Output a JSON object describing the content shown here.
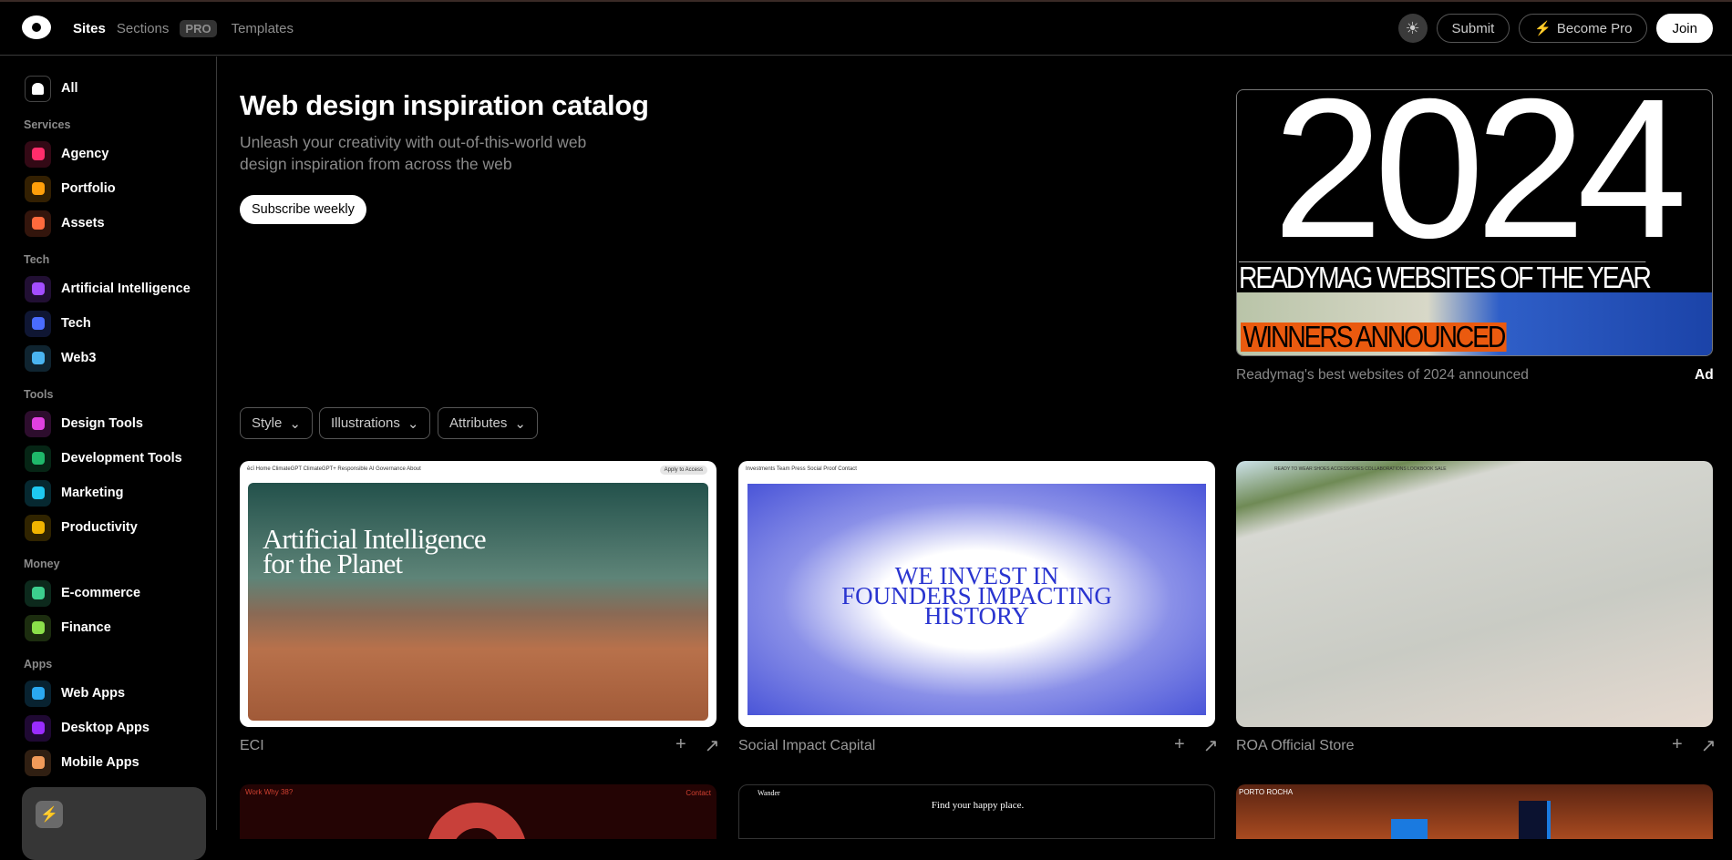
{
  "header": {
    "nav": [
      {
        "label": "Sites",
        "active": true
      },
      {
        "label": "Sections",
        "badge": "PRO"
      },
      {
        "label": "Templates"
      }
    ],
    "theme_icon": "sun-icon",
    "submit": "Submit",
    "become_pro": "Become Pro",
    "join": "Join"
  },
  "sidebar": {
    "all": "All",
    "groups": [
      {
        "label": "Services",
        "items": [
          {
            "label": "Agency",
            "icon": "people-icon",
            "color": "#ff2d6b"
          },
          {
            "label": "Portfolio",
            "icon": "person-icon",
            "color": "#ff9f0a"
          },
          {
            "label": "Assets",
            "icon": "box-icon",
            "color": "#ff6a3d"
          }
        ]
      },
      {
        "label": "Tech",
        "items": [
          {
            "label": "Artificial Intelligence",
            "icon": "sparkle-icon",
            "color": "#a34dff"
          },
          {
            "label": "Tech",
            "icon": "chip-icon",
            "color": "#4a6cff"
          },
          {
            "label": "Web3",
            "icon": "cloud-icon",
            "color": "#4ab4f0"
          }
        ]
      },
      {
        "label": "Tools",
        "items": [
          {
            "label": "Design Tools",
            "icon": "vector-icon",
            "color": "#e040e0"
          },
          {
            "label": "Development Tools",
            "icon": "code-icon",
            "color": "#1fb86a"
          },
          {
            "label": "Marketing",
            "icon": "tag-icon",
            "color": "#1ec8f0"
          },
          {
            "label": "Productivity",
            "icon": "person-check-icon",
            "color": "#f0b400"
          }
        ]
      },
      {
        "label": "Money",
        "items": [
          {
            "label": "E-commerce",
            "icon": "bag-icon",
            "color": "#3ccf8e"
          },
          {
            "label": "Finance",
            "icon": "wallet-icon",
            "color": "#8be04a"
          }
        ]
      },
      {
        "label": "Apps",
        "items": [
          {
            "label": "Web Apps",
            "icon": "compass-icon",
            "color": "#2aa8f0"
          },
          {
            "label": "Desktop Apps",
            "icon": "monitor-icon",
            "color": "#9a2cff"
          },
          {
            "label": "Mobile Apps",
            "icon": "phone-icon",
            "color": "#f09a5a"
          }
        ]
      }
    ]
  },
  "hero": {
    "title": "Web design inspiration catalog",
    "subtitle": "Unleash your creativity with out-of-this-world web design inspiration from across the web",
    "subscribe": "Subscribe weekly"
  },
  "ad": {
    "year": "2024",
    "line1": "READYMAG WEBSITES OF THE YEAR",
    "line2": "WINNERS ANNOUNCED",
    "caption": "Readymag's best websites of 2024 announced",
    "label": "Ad"
  },
  "filters": [
    "Style",
    "Illustrations",
    "Attributes"
  ],
  "cards": [
    {
      "title": "ECI",
      "headline": "Artificial Intelligence for the Planet",
      "nav": "ēcī   Home   ClimateGPT   ClimateGPT+   Responsible AI   Governance   About",
      "cta": "Apply to Access"
    },
    {
      "title": "Social Impact Capital",
      "headline": "WE INVEST IN FOUNDERS IMPACTING HISTORY",
      "nav": "Investments   Team   Press   Social Proof   Contact"
    },
    {
      "title": "ROA Official Store",
      "nav": "READY TO WEAR   SHOES   ACCESSORIES   COLLABORATIONS   LOOKBOOK   SALE"
    }
  ],
  "row2": [
    {
      "nav": "Work   Why 38?",
      "cta": "Contact"
    },
    {
      "brand": "Wander",
      "headline": "Find your happy place."
    },
    {
      "brand": "PORTO ROCHA"
    }
  ]
}
